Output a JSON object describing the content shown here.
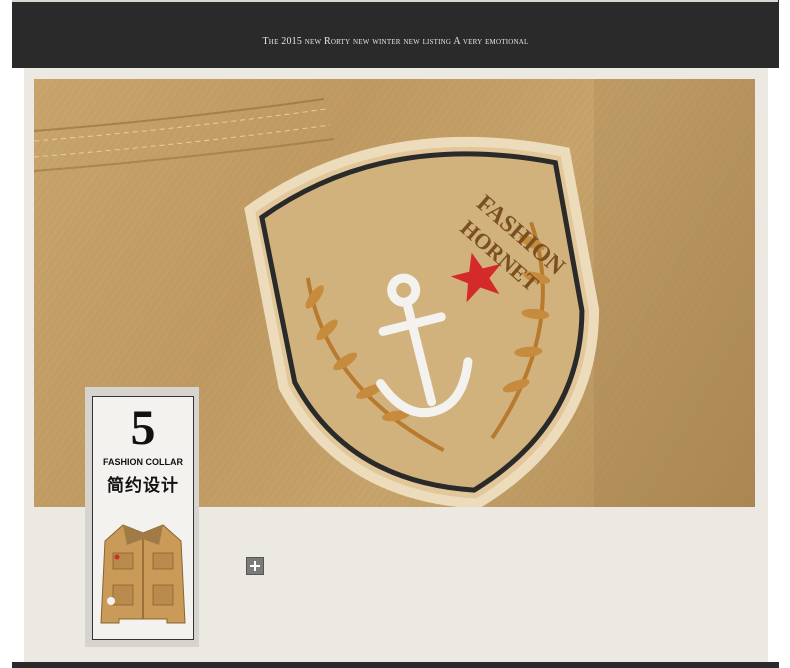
{
  "banner": {
    "text": "The 2015 new Rorty new winter new listing  A very emotional"
  },
  "photo": {
    "description_icon": "embroidered-badge-image",
    "badge_text_line1": "FASHION",
    "badge_text_line2": "HORNET"
  },
  "feature_card": {
    "number": "5",
    "title_en": "FASHION COLLAR",
    "title_cn": "简约设计",
    "icon": "jacket-thumbnail"
  },
  "controls": {
    "expand_icon": "plus-icon"
  },
  "colors": {
    "banner_bg": "#2b2a2a",
    "panel_bg": "#ece9e3",
    "fabric": "#c7a46c",
    "star": "#d42a2a"
  }
}
